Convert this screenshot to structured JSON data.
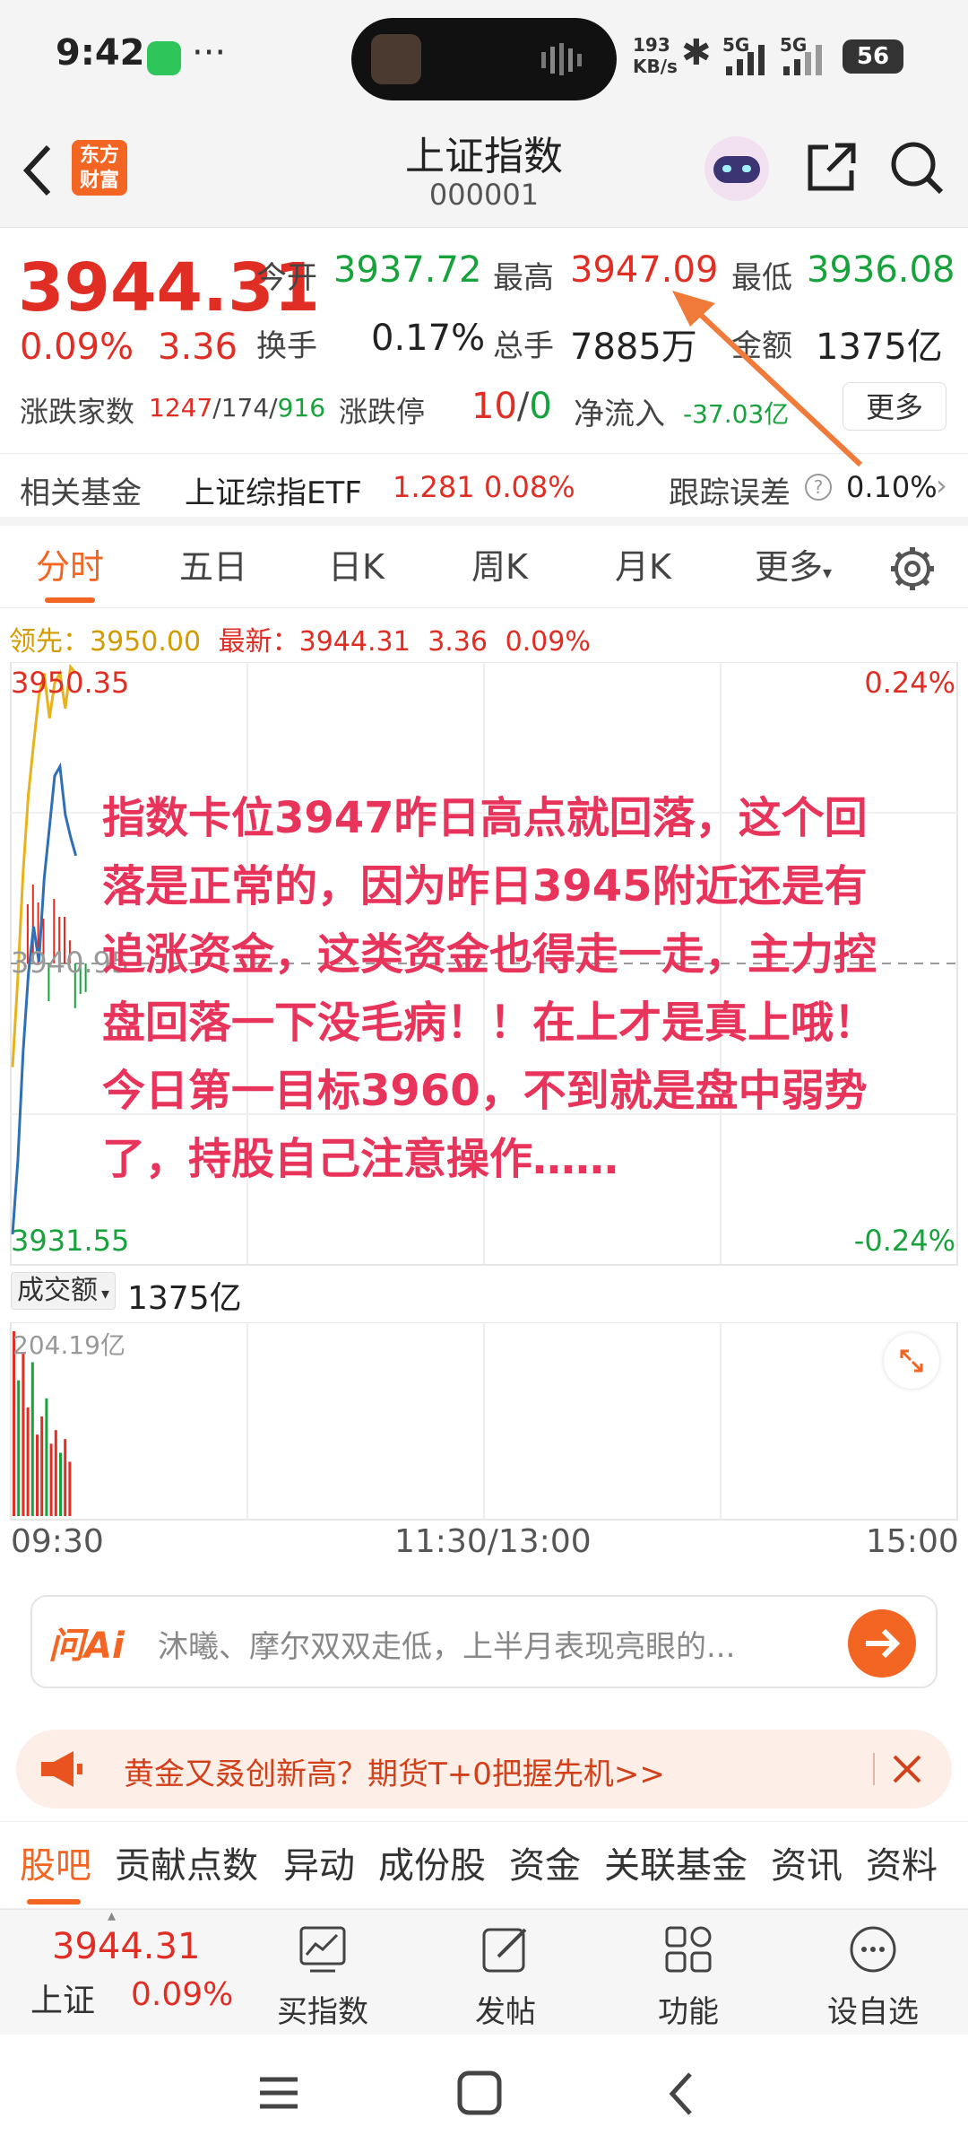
{
  "statusbar": {
    "time": "9:42",
    "dots": "···",
    "net_speed_value": "193",
    "net_speed_unit": "KB/s",
    "sig1": "5G",
    "sig2": "5G",
    "battery": "56"
  },
  "header": {
    "title": "上证指数",
    "code": "000001",
    "logo_line1": "东方",
    "logo_line2": "财富"
  },
  "quote": {
    "price": "3944.31",
    "change_pct": "0.09%",
    "change": "3.36",
    "open_label": "今开",
    "open": "3937.72",
    "high_label": "最高",
    "high": "3947.09",
    "low_label": "最低",
    "low": "3936.08",
    "turnover_label": "换手",
    "turnover": "0.17%",
    "volume_label": "总手",
    "volume": "7885万",
    "amount_label": "金额",
    "amount": "1375亿",
    "breadth_label": "涨跌家数",
    "up": "1247",
    "flat": "174",
    "down": "916",
    "limit_label": "涨跌停",
    "limit_up": "10",
    "limit_down": "0",
    "netflow_label": "净流入",
    "netflow": "-37.03亿",
    "more": "更多"
  },
  "fund": {
    "label": "相关基金",
    "name": "上证综指ETF",
    "price": "1.281",
    "pct": "0.08%",
    "tracking_label": "跟踪误差",
    "tracking": "0.10%"
  },
  "tabs": [
    {
      "label": "分时",
      "active": true
    },
    {
      "label": "五日"
    },
    {
      "label": "日K"
    },
    {
      "label": "周K"
    },
    {
      "label": "月K"
    },
    {
      "label": "更多"
    }
  ],
  "chart": {
    "leader_label": "领先：",
    "leader": "3950.00",
    "latest_label": "最新：",
    "latest": "3944.31",
    "latest_change": "3.36",
    "latest_pct": "0.09%",
    "y_top": "3950.35",
    "y_mid": "3940.95",
    "y_bottom": "3931.55",
    "pct_top": "0.24%",
    "pct_bottom": "-0.24%",
    "annotation": "指数卡位3947昨日高点就回落，这个回落是正常的，因为昨日3945附近还是有追涨资金，这类资金也得走一走，主力控盘回落一下没毛病！！在上才是真上哦！今日第一目标3960，不到就是盘中弱势了，持股自己注意操作……",
    "volume_selector": "成交额",
    "volume_total": "1375亿",
    "volume_max": "204.19亿",
    "x_start": "09:30",
    "x_mid": "11:30/13:00",
    "x_end": "15:00"
  },
  "chart_data": {
    "type": "line",
    "x": [
      "09:30",
      "09:31",
      "09:32",
      "09:33",
      "09:34",
      "09:35",
      "09:36",
      "09:37",
      "09:38",
      "09:39",
      "09:40",
      "09:41",
      "09:42"
    ],
    "series": [
      {
        "values": [
          3932.5,
          3934.8,
          3938.2,
          3940.6,
          3942.1,
          3941.0,
          3943.6,
          3945.2,
          3946.8,
          3947.09,
          3945.6,
          3944.9,
          3944.31
        ]
      },
      {
        "values": [
          3937.72,
          3940.5,
          3943.8,
          3946.2,
          3947.8,
          3949.3,
          3950.0,
          3948.6,
          3949.7,
          3950.0,
          3948.9,
          3950.2,
          3950.0
        ]
      }
    ],
    "volume": [
      204.19,
      150,
      180,
      120,
      170,
      90,
      110,
      130,
      80,
      95,
      70,
      85,
      60
    ],
    "ylim": [
      3931.55,
      3950.35
    ],
    "ref": 3940.95,
    "xlabel": "",
    "ylabel": ""
  },
  "ask": {
    "logo": "问Ai",
    "placeholder": "沐曦、摩尔双双走低，上半月表现亮眼的..."
  },
  "ad": {
    "text": "黄金又叒创新高？期货T+0把握先机>>"
  },
  "bottom_tabs": [
    "股吧",
    "贡献点数",
    "异动",
    "成份股",
    "资金",
    "关联基金",
    "资讯",
    "资料"
  ],
  "nav": {
    "price": "3944.31",
    "name": "上证",
    "pct": "0.09%",
    "buy": "买指数",
    "post": "发帖",
    "func": "功能",
    "watch": "设自选"
  },
  "colors": {
    "up": "#e02e24",
    "down": "#17a23c",
    "accent": "#f26522",
    "annotation": "#e8335a"
  }
}
